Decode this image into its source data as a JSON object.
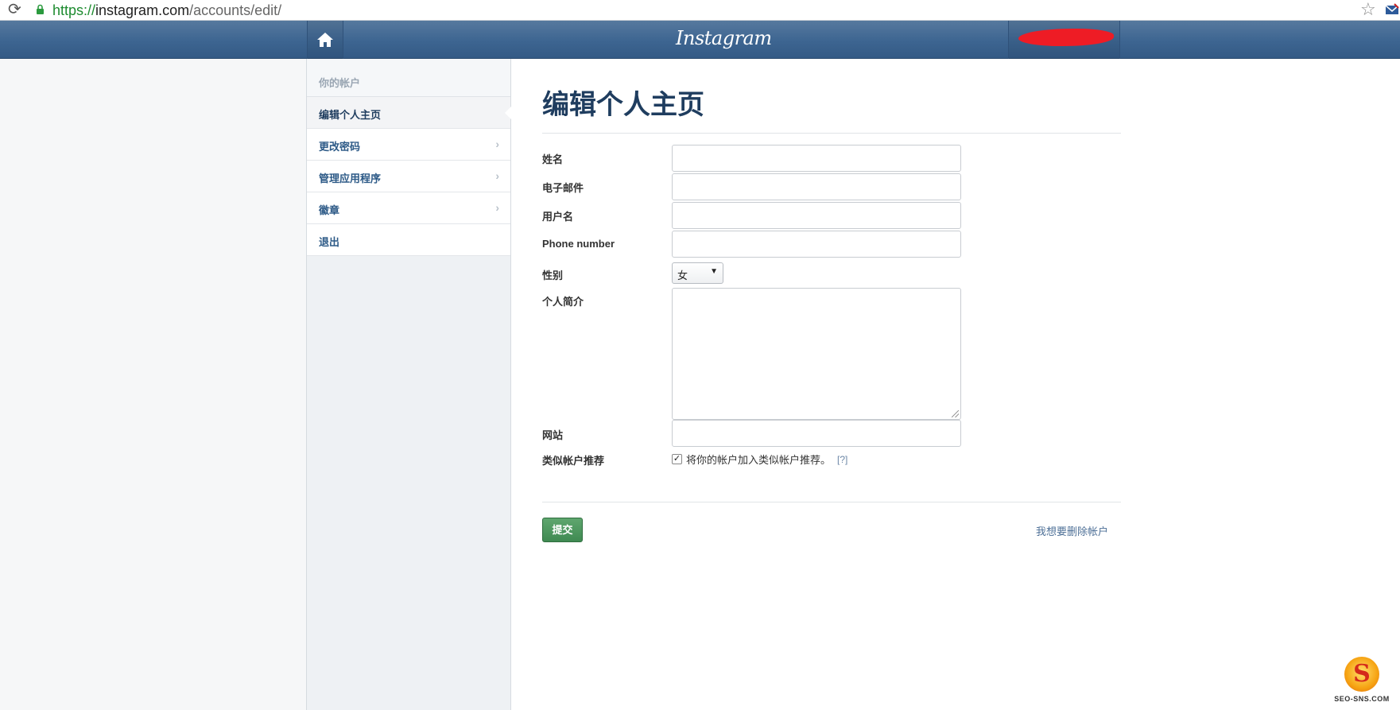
{
  "browser": {
    "url_scheme": "https://",
    "url_host": "instagram.com",
    "url_path": "/accounts/edit/"
  },
  "navbar": {
    "logo": "Instagram"
  },
  "sidebar": {
    "heading": "你的帐户",
    "items": [
      {
        "label": "编辑个人主页",
        "active": true
      },
      {
        "label": "更改密码"
      },
      {
        "label": "管理应用程序"
      },
      {
        "label": "徽章"
      },
      {
        "label": "退出"
      }
    ]
  },
  "main": {
    "title": "编辑个人主页",
    "fields": {
      "name_label": "姓名",
      "email_label": "电子邮件",
      "username_label": "用户名",
      "phone_label": "Phone number",
      "gender_label": "性别",
      "gender_value": "女",
      "bio_label": "个人简介",
      "website_label": "网站",
      "similar_label": "类似帐户推荐",
      "similar_checkbox_text": "将你的帐户加入类似帐户推荐。",
      "similar_checked": true,
      "help_link": "[?]"
    },
    "submit_label": "提交",
    "delete_link": "我想要删除帐户"
  },
  "watermark": {
    "text": "SEO-SNS.COM"
  },
  "colors": {
    "navbar": "#3d6591",
    "title": "#1f3d5f",
    "submit": "#4a9a5e"
  }
}
